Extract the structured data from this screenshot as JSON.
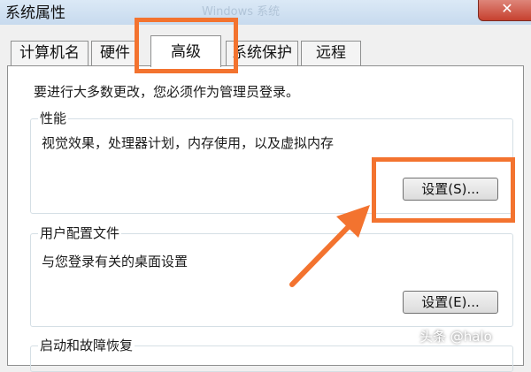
{
  "window": {
    "title": "系统属性",
    "faded_title": "Windows 系统",
    "close_label": "✕"
  },
  "tabs": [
    {
      "label": "计算机名",
      "active": false
    },
    {
      "label": "硬件",
      "active": false
    },
    {
      "label": "高级",
      "active": true
    },
    {
      "label": "系统保护",
      "active": false
    },
    {
      "label": "远程",
      "active": false
    }
  ],
  "advanced": {
    "admin_note": "要进行大多数更改，您必须作为管理员登录。",
    "performance": {
      "title": "性能",
      "description": "视觉效果，处理器计划，内存使用，以及虚拟内存",
      "button": "设置(S)..."
    },
    "user_profiles": {
      "title": "用户配置文件",
      "description": "与您登录有关的桌面设置",
      "button": "设置(E)..."
    },
    "startup_recovery": {
      "title": "启动和故障恢复"
    }
  },
  "annotations": {
    "highlight_color": "#f3732f"
  },
  "watermark": "头条 @halo"
}
